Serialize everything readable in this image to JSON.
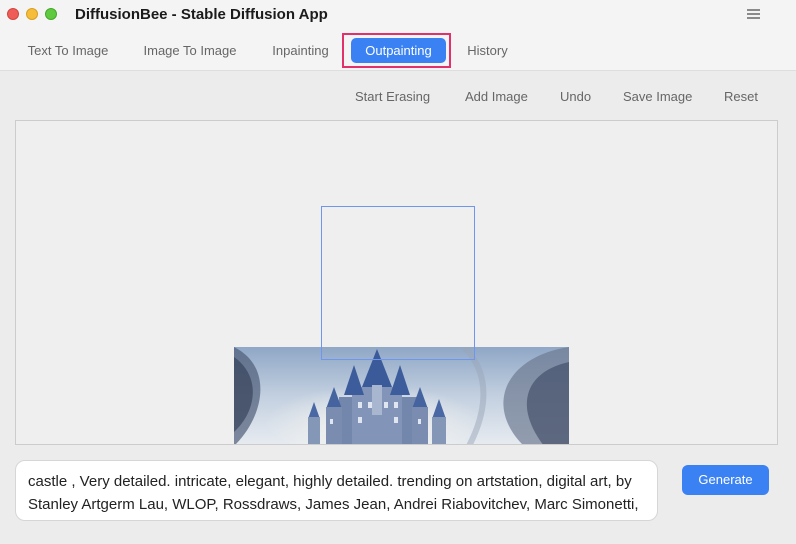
{
  "window": {
    "title": "DiffusionBee - Stable Diffusion App"
  },
  "tabs": [
    {
      "label": "Text To Image",
      "active": false
    },
    {
      "label": "Image To Image",
      "active": false
    },
    {
      "label": "Inpainting",
      "active": false
    },
    {
      "label": "Outpainting",
      "active": true
    },
    {
      "label": "History",
      "active": false
    }
  ],
  "toolbar": {
    "start_erasing": "Start Erasing",
    "add_image": "Add Image",
    "undo": "Undo",
    "save_image": "Save Image",
    "reset": "Reset"
  },
  "prompt": {
    "value": "castle , Very detailed. intricate, elegant, highly detailed. trending on artstation, digital art, by Stanley Artgerm Lau, WLOP, Rossdraws, James Jean, Andrei Riabovitchev, Marc Simonetti, Yoshitaka Amano"
  },
  "generate": {
    "label": "Generate"
  },
  "icons": {
    "menu": "hamburger-menu-icon"
  },
  "colors": {
    "accent": "#3a81f4",
    "highlight_border": "#e2306c"
  }
}
